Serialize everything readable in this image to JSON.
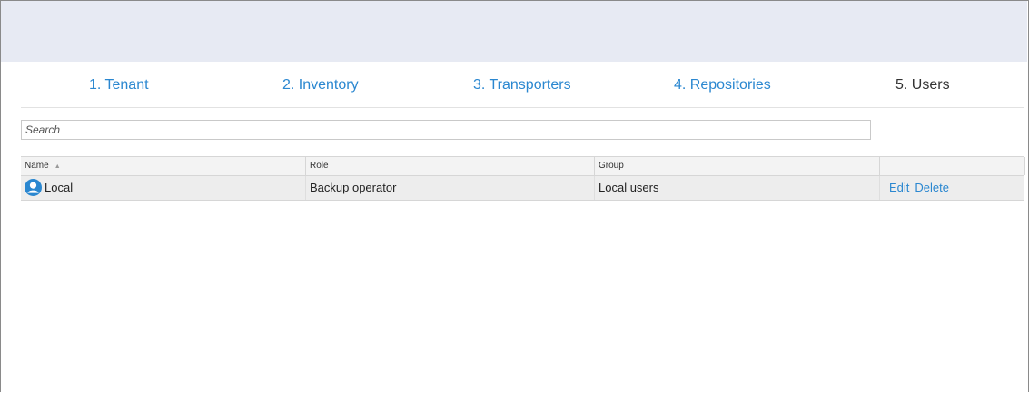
{
  "steps": [
    {
      "label": "1. Tenant",
      "active": false
    },
    {
      "label": "2. Inventory",
      "active": false
    },
    {
      "label": "3. Transporters",
      "active": false
    },
    {
      "label": "4. Repositories",
      "active": false
    },
    {
      "label": "5. Users",
      "active": true
    }
  ],
  "search": {
    "placeholder": "Search",
    "value": ""
  },
  "table": {
    "columns": [
      "Name",
      "Role",
      "Group",
      ""
    ],
    "sorted_column": "Name",
    "sort_direction": "ascending",
    "rows": [
      {
        "name": "Local",
        "icon": "user-icon",
        "role": "Backup operator",
        "group": "Local users",
        "actions": [
          "Edit",
          "Delete"
        ]
      }
    ]
  },
  "colors": {
    "link": "#2a87d0",
    "header_band": "#e7eaf3",
    "row_bg": "#ededed",
    "user_icon": "#2a87d0"
  }
}
